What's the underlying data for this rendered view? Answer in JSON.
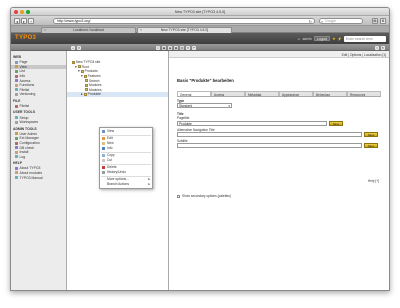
{
  "window": {
    "title": "New TYPO3 site [TYPO3 4.5.0]"
  },
  "browser": {
    "url": "http://www.typo3.org/",
    "search_placeholder": "Google",
    "tabs": [
      {
        "label": "Localhost / localhost"
      },
      {
        "label": "New TYPO3 site [TYPO3 4.5.0]"
      }
    ]
  },
  "header": {
    "logo_text": "TYPO3",
    "user_label": "admin",
    "logout_label": "Logout",
    "search_placeholder": "Enter search term"
  },
  "modules": [
    {
      "group": "WEB",
      "items": [
        "Page",
        "View",
        "List",
        "Info",
        "Access",
        "Functions",
        "Filelist",
        "Versioning"
      ]
    },
    {
      "group": "FILE",
      "items": [
        "Filelist"
      ]
    },
    {
      "group": "USER TOOLS",
      "items": [
        "Setup",
        "Workspaces"
      ]
    },
    {
      "group": "ADMIN TOOLS",
      "items": [
        "User Admin",
        "Ext Manager",
        "Configuration",
        "DB check",
        "Install",
        "Log"
      ]
    },
    {
      "group": "HELP",
      "items": [
        "About TYPO3",
        "About modules",
        "TYPO3 Manual"
      ]
    }
  ],
  "pagetree": {
    "rows": [
      "New TYPO3 site",
      "Root",
      "Products",
      "Features",
      "Search",
      "Modules",
      "Produkte"
    ]
  },
  "context_menu": {
    "items": [
      "View",
      "Edit",
      "New",
      "Info",
      "Copy",
      "Cut",
      "Delete",
      "History/Undo",
      "More options...",
      "Branch Actions"
    ]
  },
  "content": {
    "topbar_right": "Edit | Options | Localization [1]",
    "title": "Basis \"Produkte\" bearbeiten",
    "tabs": [
      "General",
      "Access",
      "Metadata",
      "Appearance",
      "Behaviour",
      "Resources",
      "Extended"
    ],
    "fields": {
      "type_label": "Type",
      "type_value": "Standard",
      "title_label": "Title",
      "page_title_label": "Pagetitle",
      "page_title_value": "Produkte",
      "subtitle_label": "Subtitle",
      "nav_title_label": "Alternative Navigation Title",
      "abstract_label": "Abstract"
    },
    "button_label": "Save",
    "help_label": "Help [+]",
    "checkbox_label": "Show secondary options (palettes)"
  }
}
